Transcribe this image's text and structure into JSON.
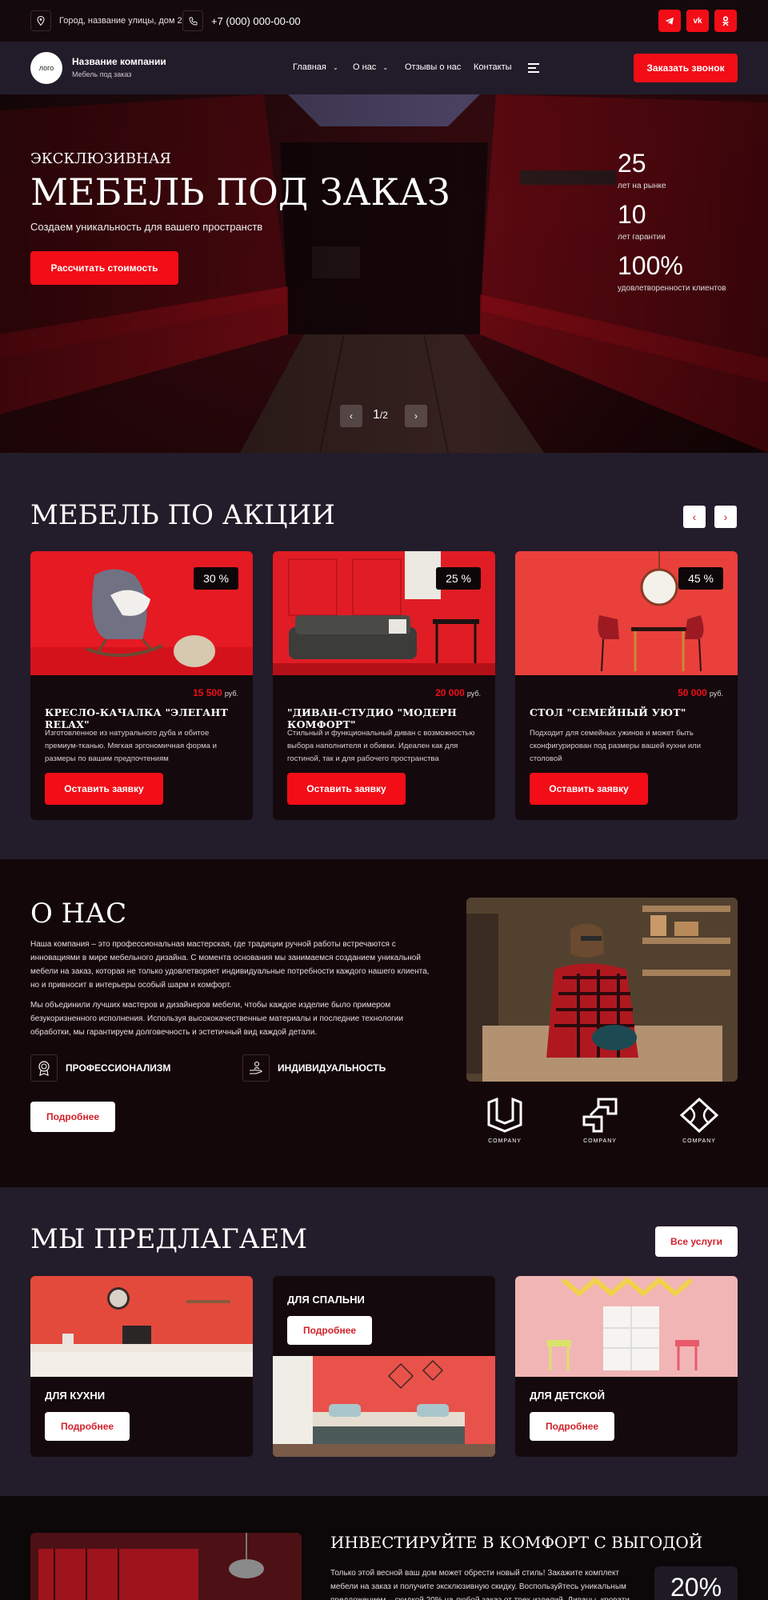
{
  "topbar": {
    "address": "Город, название улицы, дом 2",
    "phone": "+7 (000) 000-00-00",
    "socials": [
      "telegram-icon",
      "vk-icon",
      "ok-icon"
    ]
  },
  "nav": {
    "logo": "лого",
    "company_name": "Название компании",
    "company_sub": "Мебель под заказ",
    "menu": [
      {
        "label": "Главная",
        "dropdown": true
      },
      {
        "label": "О нас",
        "dropdown": true
      },
      {
        "label": "Отзывы о нас",
        "dropdown": false
      },
      {
        "label": "Контакты",
        "dropdown": false
      }
    ],
    "cta": "Заказать звонок"
  },
  "hero": {
    "kicker": "ЭКСКЛЮЗИВНАЯ",
    "title": "МЕБЕЛЬ ПОД ЗАКАЗ",
    "subtitle": "Создаем уникальность для вашего пространств",
    "button": "Рассчитать стоимость",
    "stats": [
      {
        "value": "25",
        "label": "лет на рынке"
      },
      {
        "value": "10",
        "label": "лет гарантии"
      },
      {
        "value": "100%",
        "label": "удовлетворенности  клиентов"
      }
    ],
    "slider": {
      "current": "1",
      "total": "/2"
    }
  },
  "promo": {
    "title": "МЕБЕЛЬ ПО АКЦИИ",
    "cards": [
      {
        "discount": "30 %",
        "price": "15 500",
        "currency": "руб.",
        "title": "КРЕСЛО-КАЧАЛКА \"ЭЛЕГАНТ RELAX\"",
        "desc": "Изготовленное из натурального дуба и обитое премиум-тканью. Мягкая эргономичная форма и размеры по вашим предпочтениям",
        "button": "Оставить заявку"
      },
      {
        "discount": "25 %",
        "price": "20 000",
        "currency": "руб.",
        "title": "\"ДИВАН-СТУДИО \"МОДЕРН КОМФОРТ\"",
        "desc": "Стильный и функциональный диван с возможностью выбора наполнителя и обивки. Идеален как для гостиной, так и для рабочего пространства",
        "button": "Оставить заявку"
      },
      {
        "discount": "45 %",
        "price": "50 000",
        "currency": "руб.",
        "title": "СТОЛ \"СЕМЕЙНЫЙ УЮТ\"",
        "desc": "Подходит для семейных ужинов и может быть сконфигурирован под размеры вашей кухни или столовой",
        "button": "Оставить заявку"
      }
    ]
  },
  "about": {
    "title": "О НАС",
    "p1": "Наша компания – это профессиональная мастерская, где традиции ручной работы встречаются с инновациями в мире мебельного дизайна. С момента основания мы занимаемся созданием уникальной мебели на заказ, которая не только удовлетворяет индивидуальные потребности каждого нашего клиента, но и привносит в интерьеры особый шарм и комфорт.",
    "p2": "Мы объединили лучших мастеров и дизайнеров мебели, чтобы каждое изделие было примером безукоризненного исполнения. Используя высококачественные материалы и последние технологии обработки, мы гарантируем долговечность и эстетичный вид каждой детали.",
    "features": [
      "ПРОФЕССИОНАЛИЗМ",
      "ИНДИВИДУАЛЬНОСТЬ"
    ],
    "button": "Подробнее",
    "partners": [
      "COMPANY",
      "COMPANY",
      "COMPANY"
    ]
  },
  "offer": {
    "title": "МЫ  ПРЕДЛАГАЕМ",
    "all_button": "Все услуги",
    "cards": [
      {
        "label": "ДЛЯ КУХНИ",
        "button": "Подробнее"
      },
      {
        "label": "ДЛЯ СПАЛЬНИ",
        "button": "Подробнее"
      },
      {
        "label": "ДЛЯ ДЕТСКОЙ",
        "button": "Подробнее"
      }
    ]
  },
  "invest": {
    "title": "ИНВЕСТИРУЙТЕ В КОМФОРТ С ВЫГОДОЙ",
    "text": "Только этой весной ваш дом может обрести новый стиль! Закажите комплект мебели на заказ и получите эксклюзивную скидку. Воспользуйтесь уникальным предложением – скидкой 20% на любой заказ от трех изделий. Диваны, кровати, шкафы, столы – все",
    "discount": "20%"
  },
  "colors": {
    "accent": "#f20d17",
    "dark": "#14090c",
    "section": "#231c2a"
  }
}
